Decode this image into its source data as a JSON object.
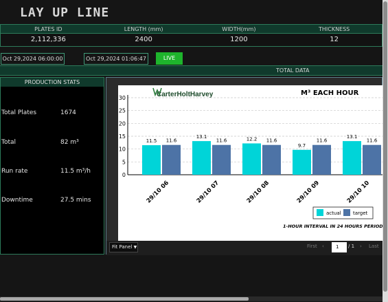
{
  "page": {
    "title": "LAY UP LINE"
  },
  "info": {
    "headers": [
      "PLATES ID",
      "LENGTH (mm)",
      "WIDTH(mm)",
      "THICKNESS"
    ],
    "values": [
      "2,112,336",
      "2400",
      "1200",
      "12"
    ]
  },
  "controls": {
    "start_time": "Oct 29,2024 06:00:00 am",
    "end_time": "Oct 29,2024 01:06:47 pm",
    "live_label": "LIVE",
    "live_color": "#1eb42c"
  },
  "total_data_label": "TOTAL DATA",
  "stats": {
    "title": "PRODUCTION STATS",
    "rows": [
      {
        "label": "Total Plates",
        "value": "1674"
      },
      {
        "label": "Total",
        "value": "82 m³"
      },
      {
        "label": "Run rate",
        "value": "11.5 m³/h"
      },
      {
        "label": "Downtime",
        "value": "27.5 mins"
      }
    ]
  },
  "chart_data": {
    "type": "bar",
    "title": "M³ EACH HOUR",
    "brand": "CarterHoltHarvey",
    "categories": [
      "29/10 06",
      "29/10 07",
      "29/10 08",
      "29/10 09",
      "29/10 10"
    ],
    "series": [
      {
        "name": "actual",
        "color": "#00d4d8",
        "values": [
          11.5,
          13.1,
          12.2,
          9.7,
          13.1
        ]
      },
      {
        "name": "target",
        "color": "#4d73a6",
        "values": [
          11.6,
          11.6,
          11.6,
          11.6,
          11.6
        ]
      }
    ],
    "ylim": [
      0,
      30
    ],
    "yticks": [
      0,
      5,
      10,
      15,
      20,
      25,
      30
    ],
    "grid": true,
    "legend_position": "bottom-right",
    "note": "1-HOUR INTERVAL IN 24 HOURS PERIOD"
  },
  "footer": {
    "fit_label": "Fit Panel",
    "first_label": "First",
    "last_label": "Last",
    "page_value": "1",
    "page_total": "/ 1",
    "prev_icon": "chevron-left-icon",
    "next_icon": "chevron-right-icon"
  }
}
